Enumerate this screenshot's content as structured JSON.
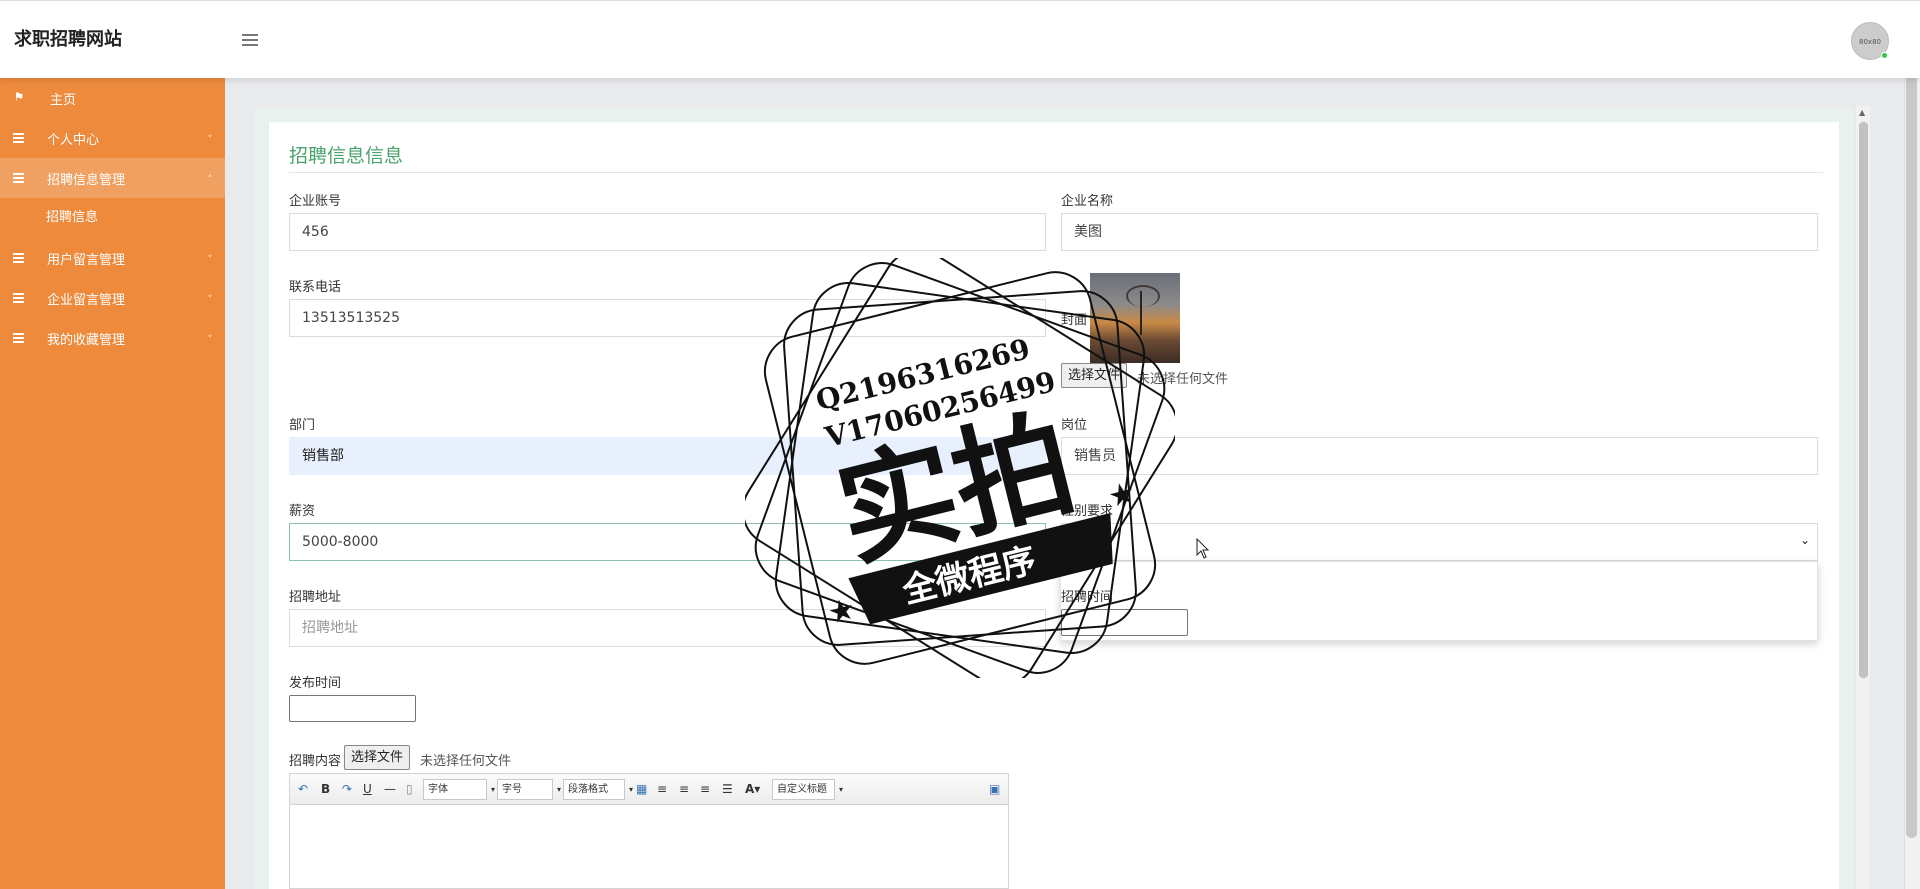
{
  "app": {
    "title": "求职招聘网站",
    "avatar_text": "80x80"
  },
  "sidebar": {
    "items": [
      {
        "label": "主页",
        "icon": "flag-icon"
      },
      {
        "label": "个人中心",
        "icon": "menu-icon"
      },
      {
        "label": "招聘信息管理",
        "icon": "menu-icon",
        "active": true
      },
      {
        "label": "用户留言管理",
        "icon": "menu-icon"
      },
      {
        "label": "企业留言管理",
        "icon": "menu-icon"
      },
      {
        "label": "我的收藏管理",
        "icon": "menu-icon"
      }
    ],
    "subitems": [
      {
        "label": "招聘信息"
      }
    ]
  },
  "form": {
    "title": "招聘信息信息",
    "company_account": {
      "label": "企业账号",
      "value": "456"
    },
    "company_name": {
      "label": "企业名称",
      "value": "美图"
    },
    "phone": {
      "label": "联系电话",
      "value": "13513513525"
    },
    "cover": {
      "label": "封面",
      "button": "选择文件",
      "file_text": "未选择任何文件"
    },
    "department": {
      "label": "部门",
      "value": "销售部"
    },
    "position": {
      "label": "岗位",
      "value": "销售员"
    },
    "salary": {
      "label": "薪资",
      "value": "5000-8000"
    },
    "gender": {
      "label": "性别要求",
      "value": ""
    },
    "address": {
      "label": "招聘地址",
      "placeholder": "招聘地址"
    },
    "recruit_time": {
      "label": "招聘时间"
    },
    "publish_time": {
      "label": "发布时间"
    },
    "content": {
      "label": "招聘内容",
      "button": "选择文件",
      "file_text": "未选择任何文件"
    }
  },
  "editor": {
    "font_label": "字体",
    "size_label": "字号",
    "format_label": "段落格式",
    "custom_label": "自定义标题"
  },
  "watermark": {
    "qq": "Q2196316269",
    "vx": "V17060256499",
    "main": "实拍",
    "banner": "全微程序"
  },
  "colors": {
    "sidebar": "#ed8a3c",
    "accent_green": "#4aa36d"
  }
}
